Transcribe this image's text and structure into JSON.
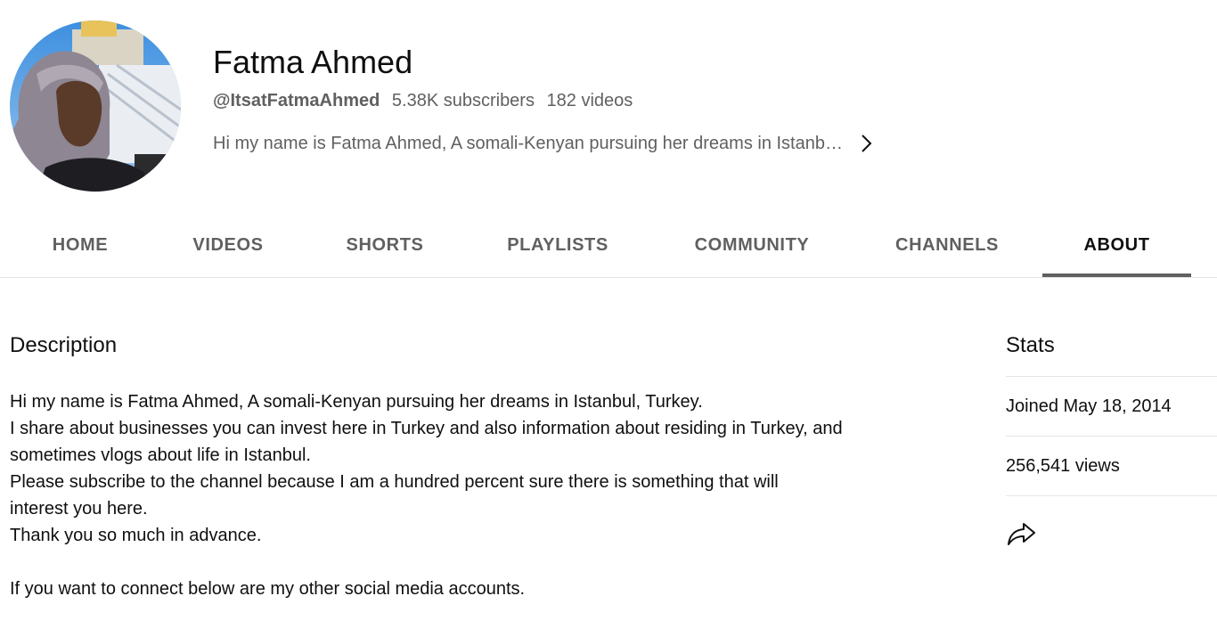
{
  "channel": {
    "name": "Fatma Ahmed",
    "handle": "@ItsatFatmaAhmed",
    "subscribers": "5.38K subscribers",
    "videos": "182 videos",
    "description_preview": "Hi my name is Fatma Ahmed, A somali-Kenyan pursuing her dreams in Istanbul, Turkey."
  },
  "tabs": [
    {
      "label": "HOME"
    },
    {
      "label": "VIDEOS"
    },
    {
      "label": "SHORTS"
    },
    {
      "label": "PLAYLISTS"
    },
    {
      "label": "COMMUNITY"
    },
    {
      "label": "CHANNELS"
    },
    {
      "label": "ABOUT",
      "active": true
    }
  ],
  "description": {
    "title": "Description",
    "lines": [
      "Hi my name is Fatma Ahmed, A somali-Kenyan pursuing her dreams in Istanbul, Turkey.",
      "I share about businesses you can invest here in Turkey and also information about residing in Turkey, and",
      "sometimes vlogs about life in Istanbul.",
      "Please subscribe to the channel because I am a hundred percent sure there is something that will",
      "interest you here.",
      "Thank you so much in advance.",
      "",
      "If you want to connect below are my other social media accounts."
    ]
  },
  "stats": {
    "title": "Stats",
    "joined": "Joined May 18, 2014",
    "views": "256,541 views"
  },
  "icons": {
    "chevron": "chevron-right-icon",
    "share": "share-icon"
  }
}
